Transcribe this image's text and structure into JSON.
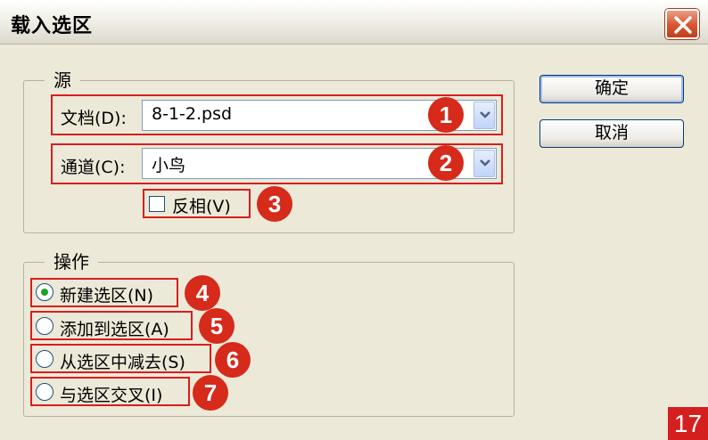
{
  "dialog": {
    "title": "载入选区"
  },
  "title_bar": {
    "close_icon": "close-icon"
  },
  "source_group": {
    "legend": "源",
    "document": {
      "label": "文档(D):",
      "value": "8-1-2.psd"
    },
    "channel": {
      "label": "通道(C):",
      "value": "小鸟"
    },
    "invert": {
      "label": "反相(V)",
      "checked": false
    }
  },
  "operation_group": {
    "legend": "操作",
    "options": [
      {
        "label": "新建选区(N)",
        "selected": true
      },
      {
        "label": "添加到选区(A)",
        "selected": false
      },
      {
        "label": "从选区中减去(S)",
        "selected": false
      },
      {
        "label": "与选区交叉(I)",
        "selected": false
      }
    ]
  },
  "buttons": {
    "ok": "确定",
    "cancel": "取消"
  },
  "callouts": [
    "1",
    "2",
    "3",
    "4",
    "5",
    "6",
    "7"
  ],
  "page_number": "17",
  "colors": {
    "callout_red": "#d62a1a",
    "radio_selected": "#21a121",
    "dialog_bg": "#ece9d8"
  }
}
